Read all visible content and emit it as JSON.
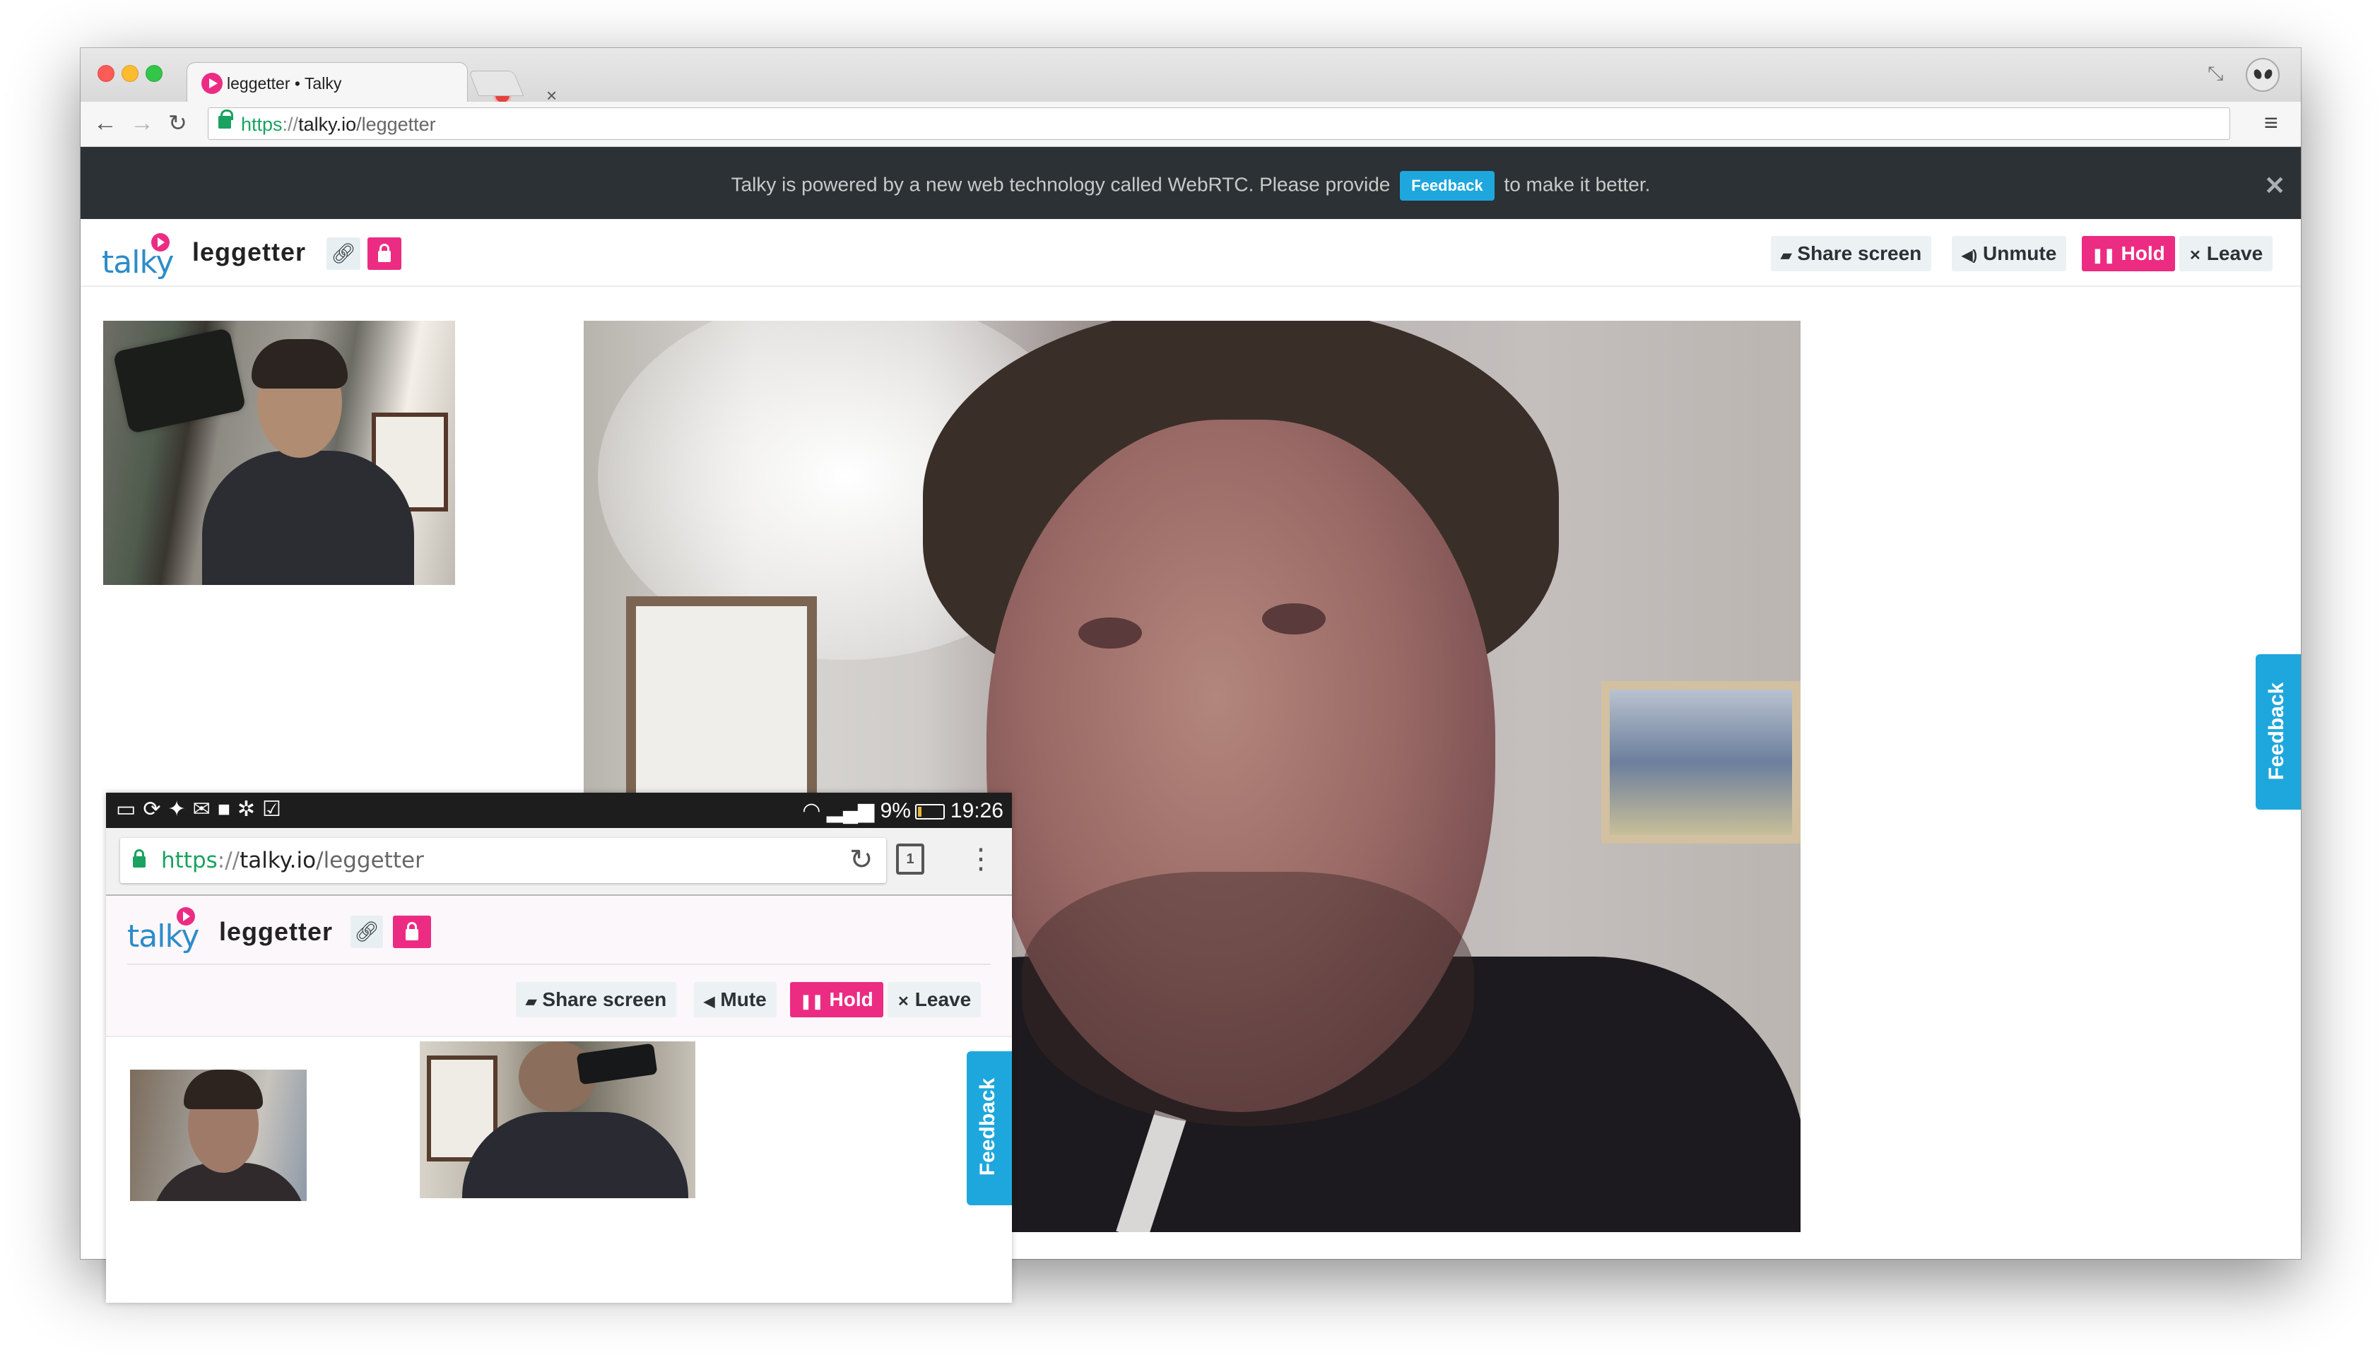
{
  "browser": {
    "tab_title": "leggetter • Talky",
    "url": {
      "scheme": "https",
      "separator": "://",
      "host": "talky.io",
      "path": "/leggetter"
    }
  },
  "banner": {
    "text_before": "Talky is powered by a new web technology called WebRTC. Please provide",
    "feedback_label": "Feedback",
    "text_after": "to make it better.",
    "close_icon": "close-icon"
  },
  "app": {
    "logo": "talky",
    "room_name": "leggetter",
    "buttons": {
      "share_screen": "Share screen",
      "unmute": "Unmute",
      "hold": "Hold",
      "leave": "Leave"
    },
    "feedback_tab": "Feedback"
  },
  "phone": {
    "status": {
      "battery": "9%",
      "time": "19:26"
    },
    "url": {
      "scheme": "https",
      "separator": "://",
      "host": "talky.io",
      "path": "/leggetter"
    },
    "tab_count": "1",
    "logo": "talky",
    "room_name": "leggetter",
    "buttons": {
      "share_screen": "Share screen",
      "mute": "Mute",
      "hold": "Hold",
      "leave": "Leave"
    },
    "feedback_tab": "Feedback"
  },
  "colors": {
    "brand_pink": "#ec2c82",
    "brand_blue": "#2d8cc9",
    "feedback_blue": "#1ea7dc",
    "banner_dark": "#2b3134"
  }
}
